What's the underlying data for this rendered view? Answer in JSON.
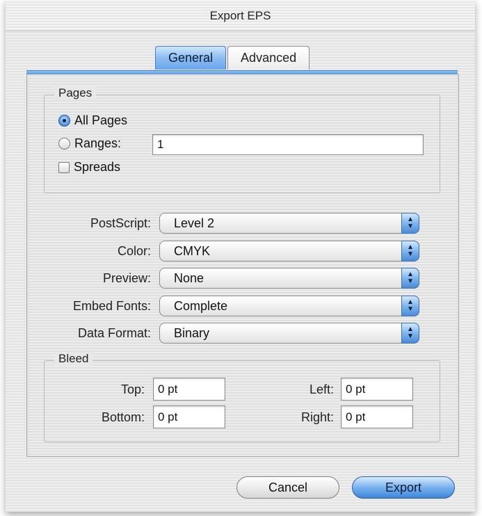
{
  "window": {
    "title": "Export EPS"
  },
  "tabs": [
    {
      "label": "General",
      "active": true
    },
    {
      "label": "Advanced",
      "active": false
    }
  ],
  "pages": {
    "legend": "Pages",
    "all_pages_label": "All Pages",
    "all_pages_selected": true,
    "ranges_label": "Ranges:",
    "ranges_value": "1",
    "spreads_label": "Spreads",
    "spreads_checked": false
  },
  "settings": [
    {
      "label": "PostScript:",
      "value": "Level 2"
    },
    {
      "label": "Color:",
      "value": "CMYK"
    },
    {
      "label": "Preview:",
      "value": "None"
    },
    {
      "label": "Embed Fonts:",
      "value": "Complete"
    },
    {
      "label": "Data Format:",
      "value": "Binary"
    }
  ],
  "bleed": {
    "legend": "Bleed",
    "top_label": "Top:",
    "top_value": "0 pt",
    "bottom_label": "Bottom:",
    "bottom_value": "0 pt",
    "left_label": "Left:",
    "left_value": "0 pt",
    "right_label": "Right:",
    "right_value": "0 pt"
  },
  "buttons": {
    "cancel": "Cancel",
    "export": "Export"
  },
  "colors": {
    "accent_blue": "#6aa6ea",
    "pinstripe_light": "#efefef",
    "pinstripe_dark": "#e3e3e3"
  }
}
